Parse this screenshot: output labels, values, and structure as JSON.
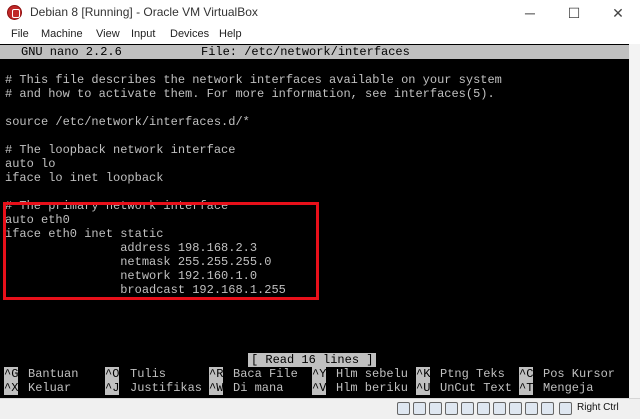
{
  "window": {
    "title": "Debian 8 [Running] - Oracle VM VirtualBox",
    "controls": {
      "minimize": "─",
      "maximize": "☐",
      "close": "✕"
    }
  },
  "menu": [
    "File",
    "Machine",
    "View",
    "Input",
    "Devices",
    "Help"
  ],
  "nano": {
    "version": "GNU nano 2.2.6",
    "file_label": "File: /etc/network/interfaces",
    "lines": [
      "# This file describes the network interfaces available on your system",
      "# and how to activate them. For more information, see interfaces(5).",
      "",
      "source /etc/network/interfaces.d/*",
      "",
      "# The loopback network interface",
      "auto lo",
      "iface lo inet loopback",
      "",
      "# The primary network interface",
      "auto eth0",
      "iface eth0 inet static",
      "                address 198.168.2.3",
      "                netmask 255.255.255.0",
      "                network 192.160.1.0",
      "                broadcast 192.168.1.255"
    ],
    "status": "[ Read 16 lines ]",
    "shortcuts_row1": [
      {
        "key": "^G",
        "label": "Bantuan"
      },
      {
        "key": "^O",
        "label": "Tulis"
      },
      {
        "key": "^R",
        "label": "Baca File"
      },
      {
        "key": "^Y",
        "label": "Hlm sebelu"
      },
      {
        "key": "^K",
        "label": "Ptng Teks"
      },
      {
        "key": "^C",
        "label": "Pos Kursor"
      }
    ],
    "shortcuts_row2": [
      {
        "key": "^X",
        "label": "Keluar"
      },
      {
        "key": "^J",
        "label": "Justifikas"
      },
      {
        "key": "^W",
        "label": "Di mana"
      },
      {
        "key": "^V",
        "label": "Hlm beriku"
      },
      {
        "key": "^U",
        "label": "UnCut Text"
      },
      {
        "key": "^T",
        "label": "Mengeja"
      }
    ]
  },
  "statusbar": {
    "host_key": "Right Ctrl",
    "icons": [
      "hard-disk-icon",
      "optical-drive-icon",
      "audio-icon",
      "network-icon",
      "usb-icon",
      "shared-folder-icon",
      "display-icon",
      "video-capture-icon",
      "cpu-icon",
      "mouse-integration-icon",
      "keyboard-icon"
    ]
  },
  "colors": {
    "highlight_box": "#e8101a",
    "console_bg": "#000000",
    "console_fg": "#c0c0c0",
    "bar_bg": "#c0c0c0"
  }
}
